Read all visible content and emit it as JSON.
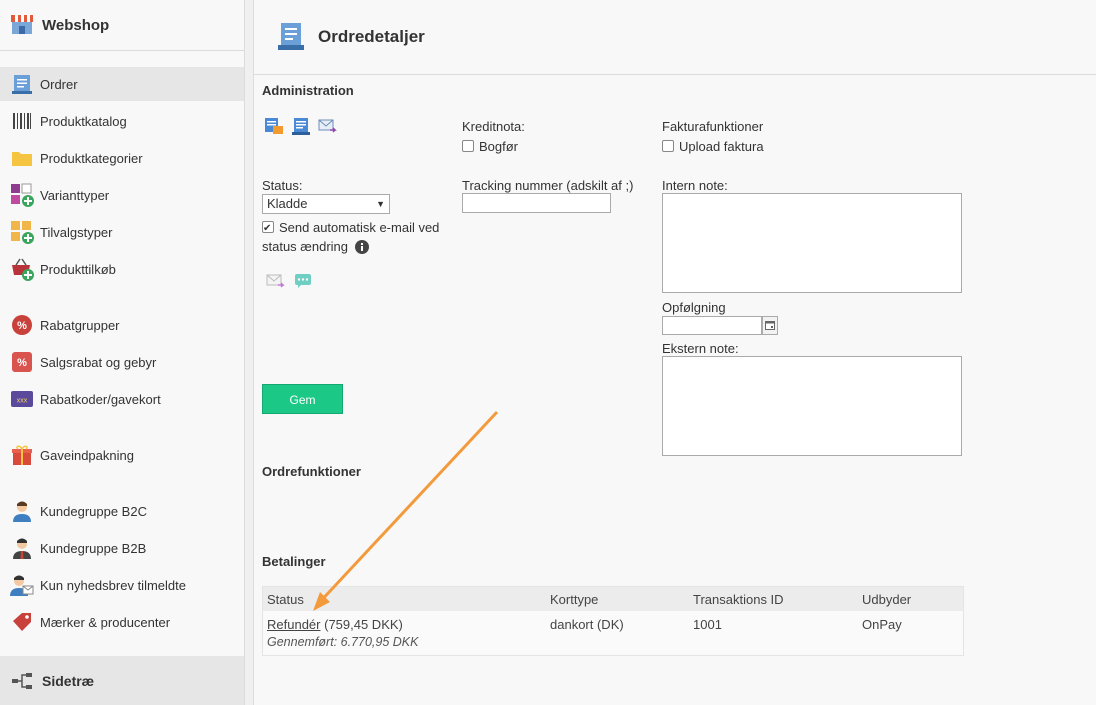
{
  "sidebar": {
    "title": "Webshop",
    "items": [
      {
        "label": "Ordrer",
        "icon": "order-icon"
      },
      {
        "label": "Produktkatalog",
        "icon": "barcode-icon"
      },
      {
        "label": "Produktkategorier",
        "icon": "folder-icon"
      },
      {
        "label": "Varianttyper",
        "icon": "variant-types-icon"
      },
      {
        "label": "Tilvalgstyper",
        "icon": "option-types-icon"
      },
      {
        "label": "Produkttilkøb",
        "icon": "basket-add-icon"
      },
      {
        "label": "Rabatgrupper",
        "icon": "discount-group-icon"
      },
      {
        "label": "Salgsrabat og gebyr",
        "icon": "percent-icon"
      },
      {
        "label": "Rabatkoder/gavekort",
        "icon": "voucher-icon"
      },
      {
        "label": "Gaveindpakning",
        "icon": "gift-icon"
      },
      {
        "label": "Kundegruppe B2C",
        "icon": "user-icon"
      },
      {
        "label": "Kundegruppe B2B",
        "icon": "user-suit-icon"
      },
      {
        "label": "Kun nyhedsbrev tilmeldte",
        "icon": "newsletter-user-icon"
      },
      {
        "label": "Mærker & producenter",
        "icon": "tag-icon"
      }
    ],
    "footer": "Sidetræ"
  },
  "header": {
    "title": "Ordredetaljer"
  },
  "administration": {
    "title": "Administration",
    "kreditnota_label": "Kreditnota:",
    "bogfor_label": "Bogfør",
    "faktura_label": "Fakturafunktioner",
    "upload_label": "Upload faktura",
    "status_label": "Status:",
    "status_value": "Kladde",
    "send_email_label_1": "Send automatisk e-mail ved",
    "send_email_label_2": "status ændring",
    "tracking_label": "Tracking nummer (adskilt af ;)",
    "tracking_value": "",
    "intern_label": "Intern note:",
    "intern_value": "",
    "opfolgning_label": "Opfølgning",
    "opfolgning_value": "",
    "ekstern_label": "Ekstern note:",
    "ekstern_value": "",
    "save_label": "Gem"
  },
  "ordrefunktioner": {
    "title": "Ordrefunktioner"
  },
  "betalinger": {
    "title": "Betalinger",
    "columns": [
      "Status",
      "Korttype",
      "Transaktions ID",
      "Udbyder"
    ],
    "row": {
      "refund_link": "Refundér",
      "amount": "(759,45 DKK)",
      "completed": "Gennemført: 6.770,95 DKK",
      "card_type": "dankort (DK)",
      "transaction_id": "1001",
      "provider": "OnPay"
    }
  },
  "colors": {
    "accent_green": "#1cc886",
    "annotation_arrow": "#f39a3c"
  }
}
